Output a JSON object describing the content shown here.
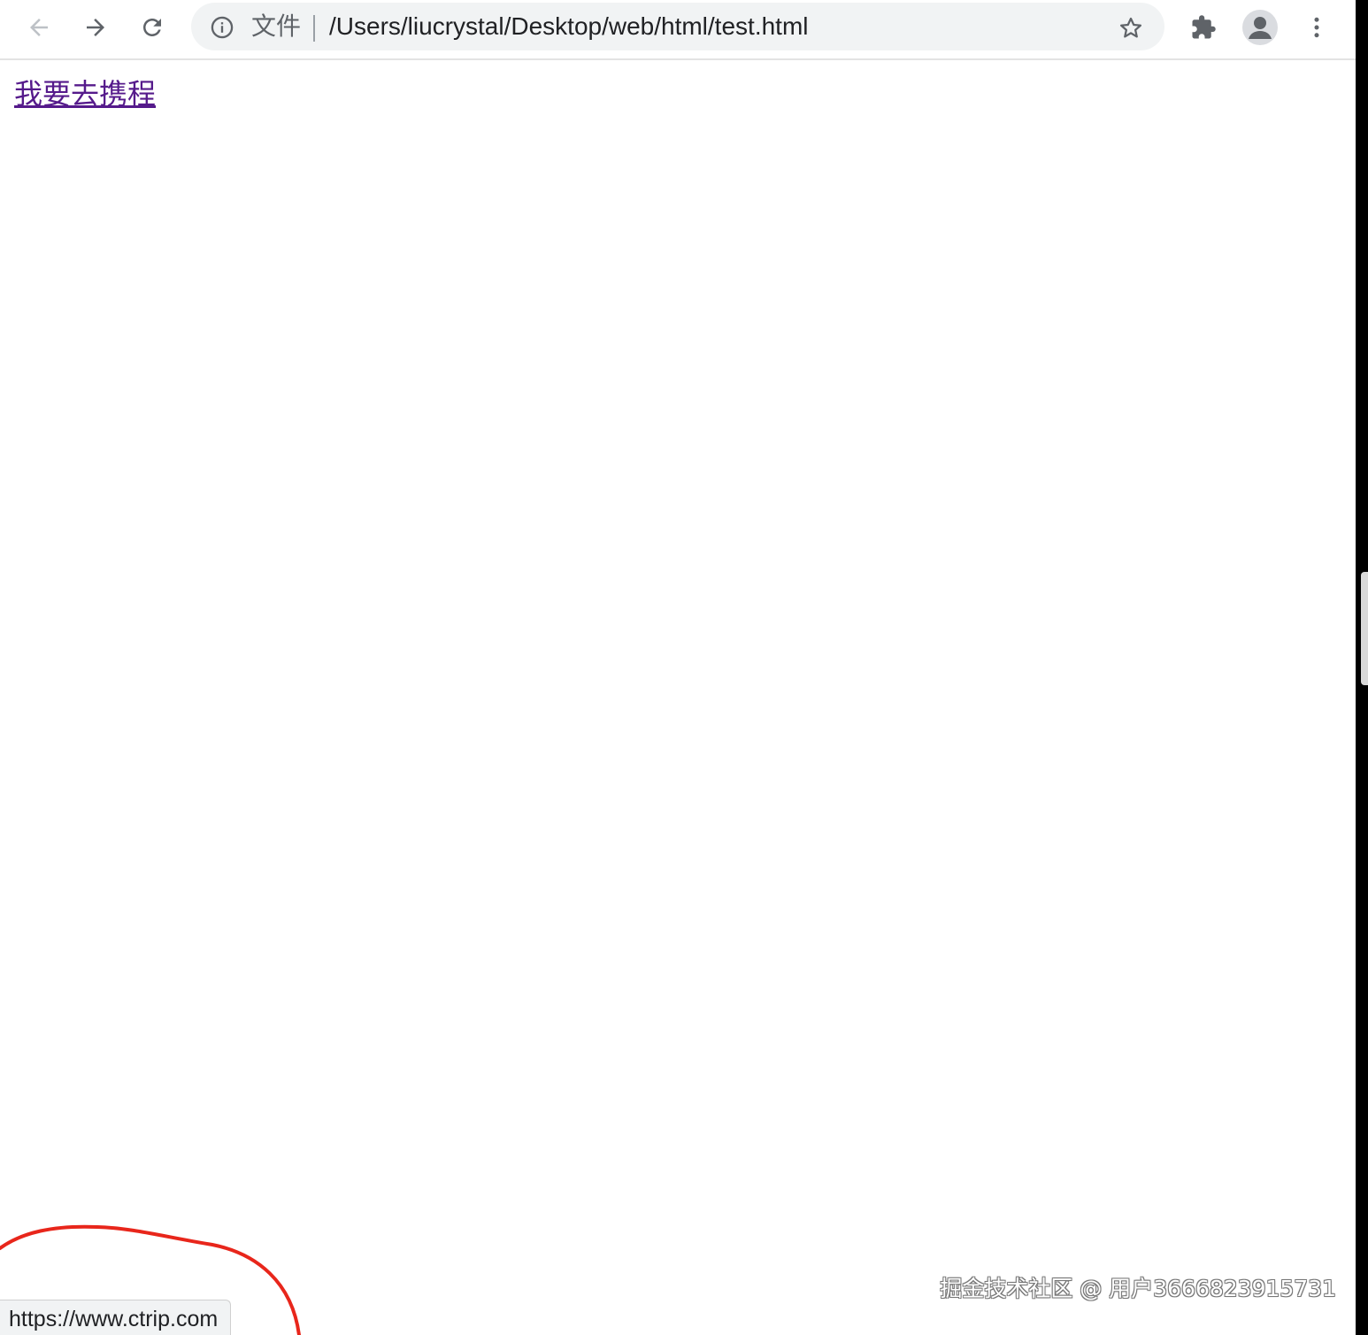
{
  "browser": {
    "omnibox": {
      "scheme_label": "文件",
      "url": "/Users/liucrystal/Desktop/web/html/test.html"
    },
    "icons": {
      "back": "back-arrow-icon",
      "forward": "forward-arrow-icon",
      "reload": "reload-icon",
      "site_info": "info-icon",
      "bookmark": "star-icon",
      "extensions": "puzzle-piece-icon",
      "profile": "person-avatar-icon",
      "menu": "kebab-menu-icon"
    }
  },
  "page": {
    "link_text": "我要去携程",
    "link_color": "#551a8b"
  },
  "status_bar": {
    "hover_url": "https://www.ctrip.com"
  },
  "annotation": {
    "color": "#e8261b",
    "shape": "hand-drawn-circle"
  },
  "watermark": {
    "text": "掘金技术社区 @ 用户3666823915731"
  }
}
